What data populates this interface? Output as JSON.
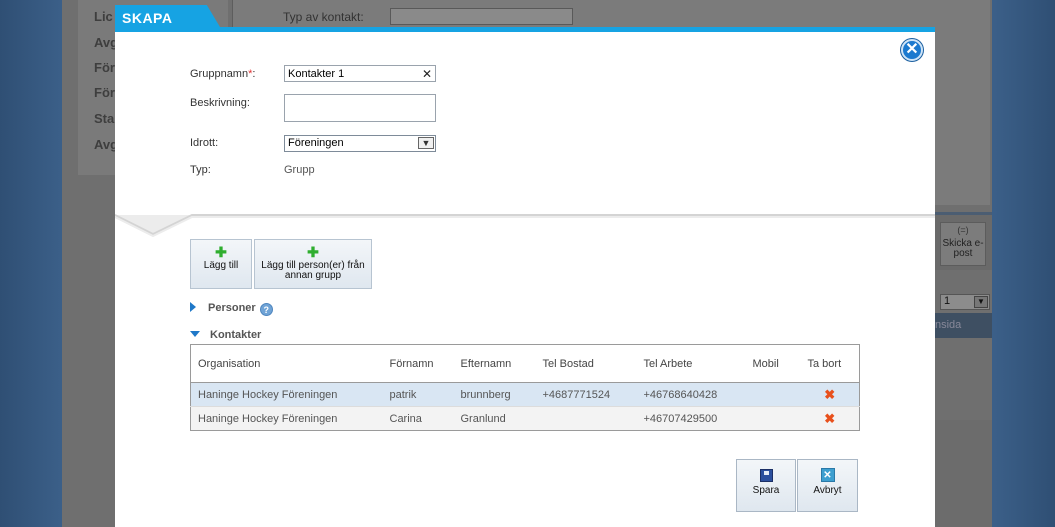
{
  "background": {
    "nav_items": [
      "Lic",
      "Avg",
      "För",
      "För",
      "Sta",
      "Avg"
    ],
    "contact_type_label": "Typ av kontakt:",
    "mail_button": "Skicka e-post",
    "mail_icon": "(=)",
    "pager_value": "1",
    "strip_text": "nsida"
  },
  "modal": {
    "tab_title": "SKAPA",
    "close_icon": "✕",
    "form": {
      "group_name_label": "Gruppnamn",
      "required_mark": "*",
      "colon": ":",
      "group_name_value": "Kontakter 1",
      "clear_icon": "✕",
      "description_label": "Beskrivning:",
      "description_value": "",
      "sport_label": "Idrott:",
      "sport_value": "Föreningen",
      "type_label": "Typ:",
      "type_value": "Grupp"
    },
    "toolbar": {
      "add_label": "Lägg till",
      "add_from_group_label": "Lägg till person(er) från annan grupp"
    },
    "sections": {
      "persons": "Personer",
      "contacts": "Kontakter",
      "help_glyph": "?"
    },
    "table": {
      "headers": [
        "Organisation",
        "Förnamn",
        "Efternamn",
        "Tel Bostad",
        "Tel Arbete",
        "Mobil",
        "Ta bort"
      ],
      "rows": [
        [
          "Haninge Hockey Föreningen",
          "patrik",
          "brunnberg",
          "+4687771524",
          "+46768640428",
          ""
        ],
        [
          "Haninge Hockey Föreningen",
          "Carina",
          "Granlund",
          "",
          "+46707429500",
          ""
        ]
      ],
      "delete_icon": "✖"
    },
    "actions": {
      "save_label": "Spara",
      "cancel_label": "Avbryt"
    }
  },
  "colors": {
    "accent": "#16a3e3",
    "selected_row": "#d9e6f3",
    "delete": "#e8501c"
  }
}
